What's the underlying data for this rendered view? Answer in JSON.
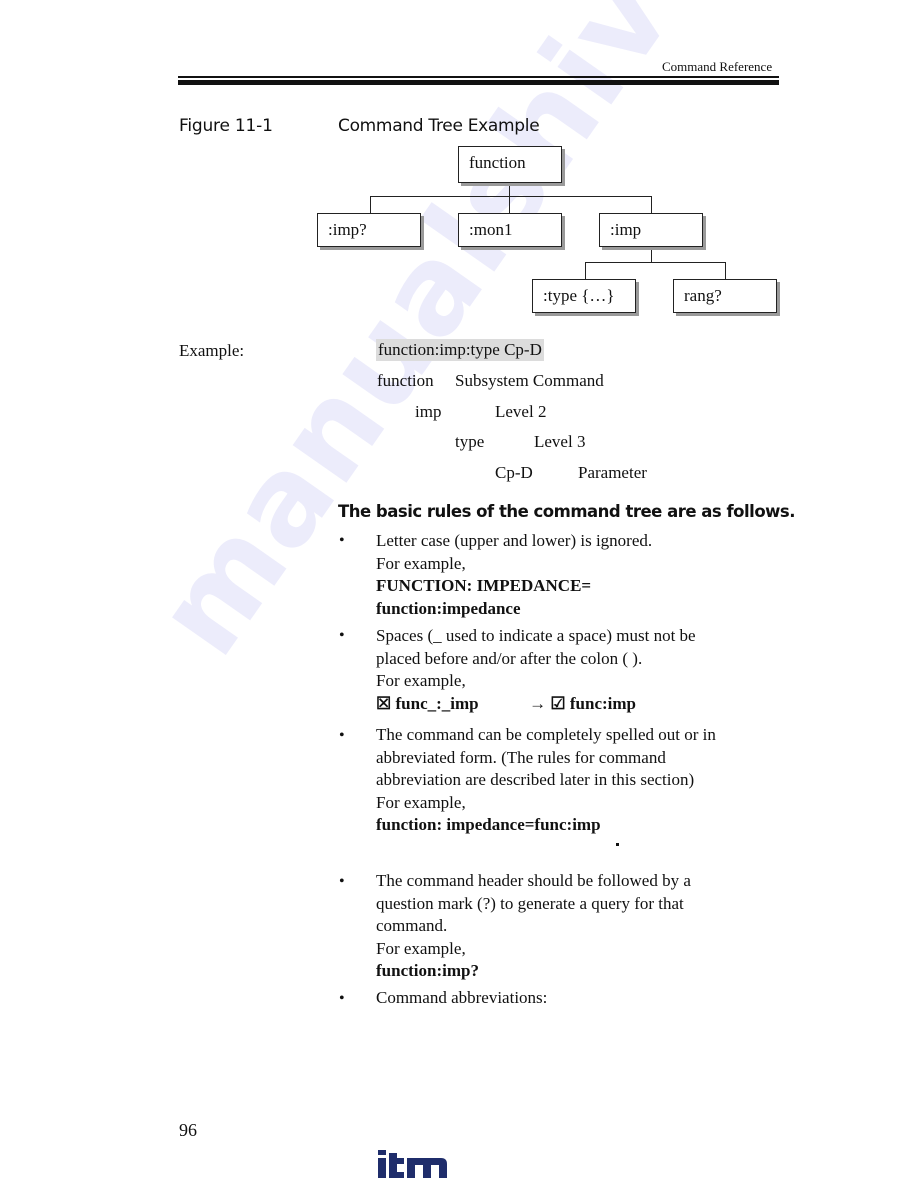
{
  "header": {
    "running_head": "Command Reference"
  },
  "figure": {
    "label": "Figure 11-1",
    "title": "Command Tree Example",
    "tree": {
      "root": "function",
      "level2": [
        ":imp?",
        ":mon1",
        ":imp"
      ],
      "level3": [
        ":type {…}",
        "rang?"
      ]
    }
  },
  "example": {
    "label": "Example:",
    "command": "function:imp:type Cp-D",
    "breakdown": [
      {
        "term": "function",
        "meaning": "Subsystem Command"
      },
      {
        "term": "imp",
        "meaning": "Level 2"
      },
      {
        "term": "type",
        "meaning": "Level 3"
      },
      {
        "term": "Cp-D",
        "meaning": "Parameter"
      }
    ]
  },
  "rules": {
    "heading": "The basic rules of the command tree are as follows.",
    "bullet_glyph": "•",
    "items": [
      {
        "lines": [
          "Letter case (upper and lower) is ignored.",
          "For example,"
        ],
        "bold_lines": [
          "FUNCTION: IMPEDANCE=",
          "function:impedance"
        ]
      },
      {
        "lines": [
          "Spaces (_ used to indicate a space) must not be",
          "placed before and/or after the colon ( ).",
          "For example,"
        ],
        "wrong_icon": "☒",
        "wrong_example": "func_:_imp",
        "arrow": "→",
        "right_icon": "☑",
        "right_example": "func:imp"
      },
      {
        "lines": [
          "The command can be completely spelled out or in",
          "abbreviated form. (The rules for command",
          "abbreviation are described later in this section)",
          "For example,"
        ],
        "bold_lines": [
          "function: impedance=func:imp"
        ]
      },
      {
        "lines": [
          "The command header should be followed by a",
          "question mark (?) to generate a query for that",
          "command.",
          "For example,"
        ],
        "bold_lines": [
          "function:imp?"
        ]
      },
      {
        "lines": [
          "Command abbreviations:"
        ]
      }
    ]
  },
  "footer": {
    "page_number": "96",
    "logo_text": "itm",
    "logo_color": "#1f2d6b"
  },
  "watermark": "manualshive.com"
}
